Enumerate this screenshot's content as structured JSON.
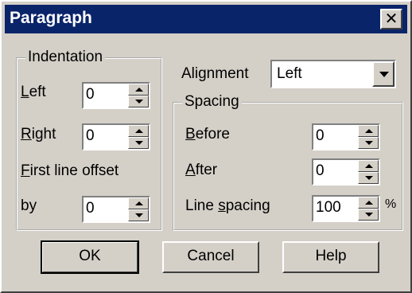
{
  "window": {
    "title": "Paragraph",
    "close_label": "✕"
  },
  "indentation": {
    "legend": "Indentation",
    "left_label_u": "L",
    "left_label_rest": "eft",
    "left_value": "0",
    "right_label_u": "R",
    "right_label_rest": "ight",
    "right_value": "0",
    "first_line_u": "F",
    "first_line_rest": "irst line offset",
    "by_label": "by",
    "by_value": "0"
  },
  "alignment": {
    "label": "Alignment",
    "value": "Left"
  },
  "spacing": {
    "legend": "Spacing",
    "before_u": "B",
    "before_rest": "efore",
    "before_value": "0",
    "after_u": "A",
    "after_rest": "fter",
    "after_value": "0",
    "line_pre": "Line ",
    "line_u": "s",
    "line_rest": "pacing",
    "line_value": "100",
    "percent": "%"
  },
  "buttons": {
    "ok": "OK",
    "cancel": "Cancel",
    "help": "Help"
  }
}
